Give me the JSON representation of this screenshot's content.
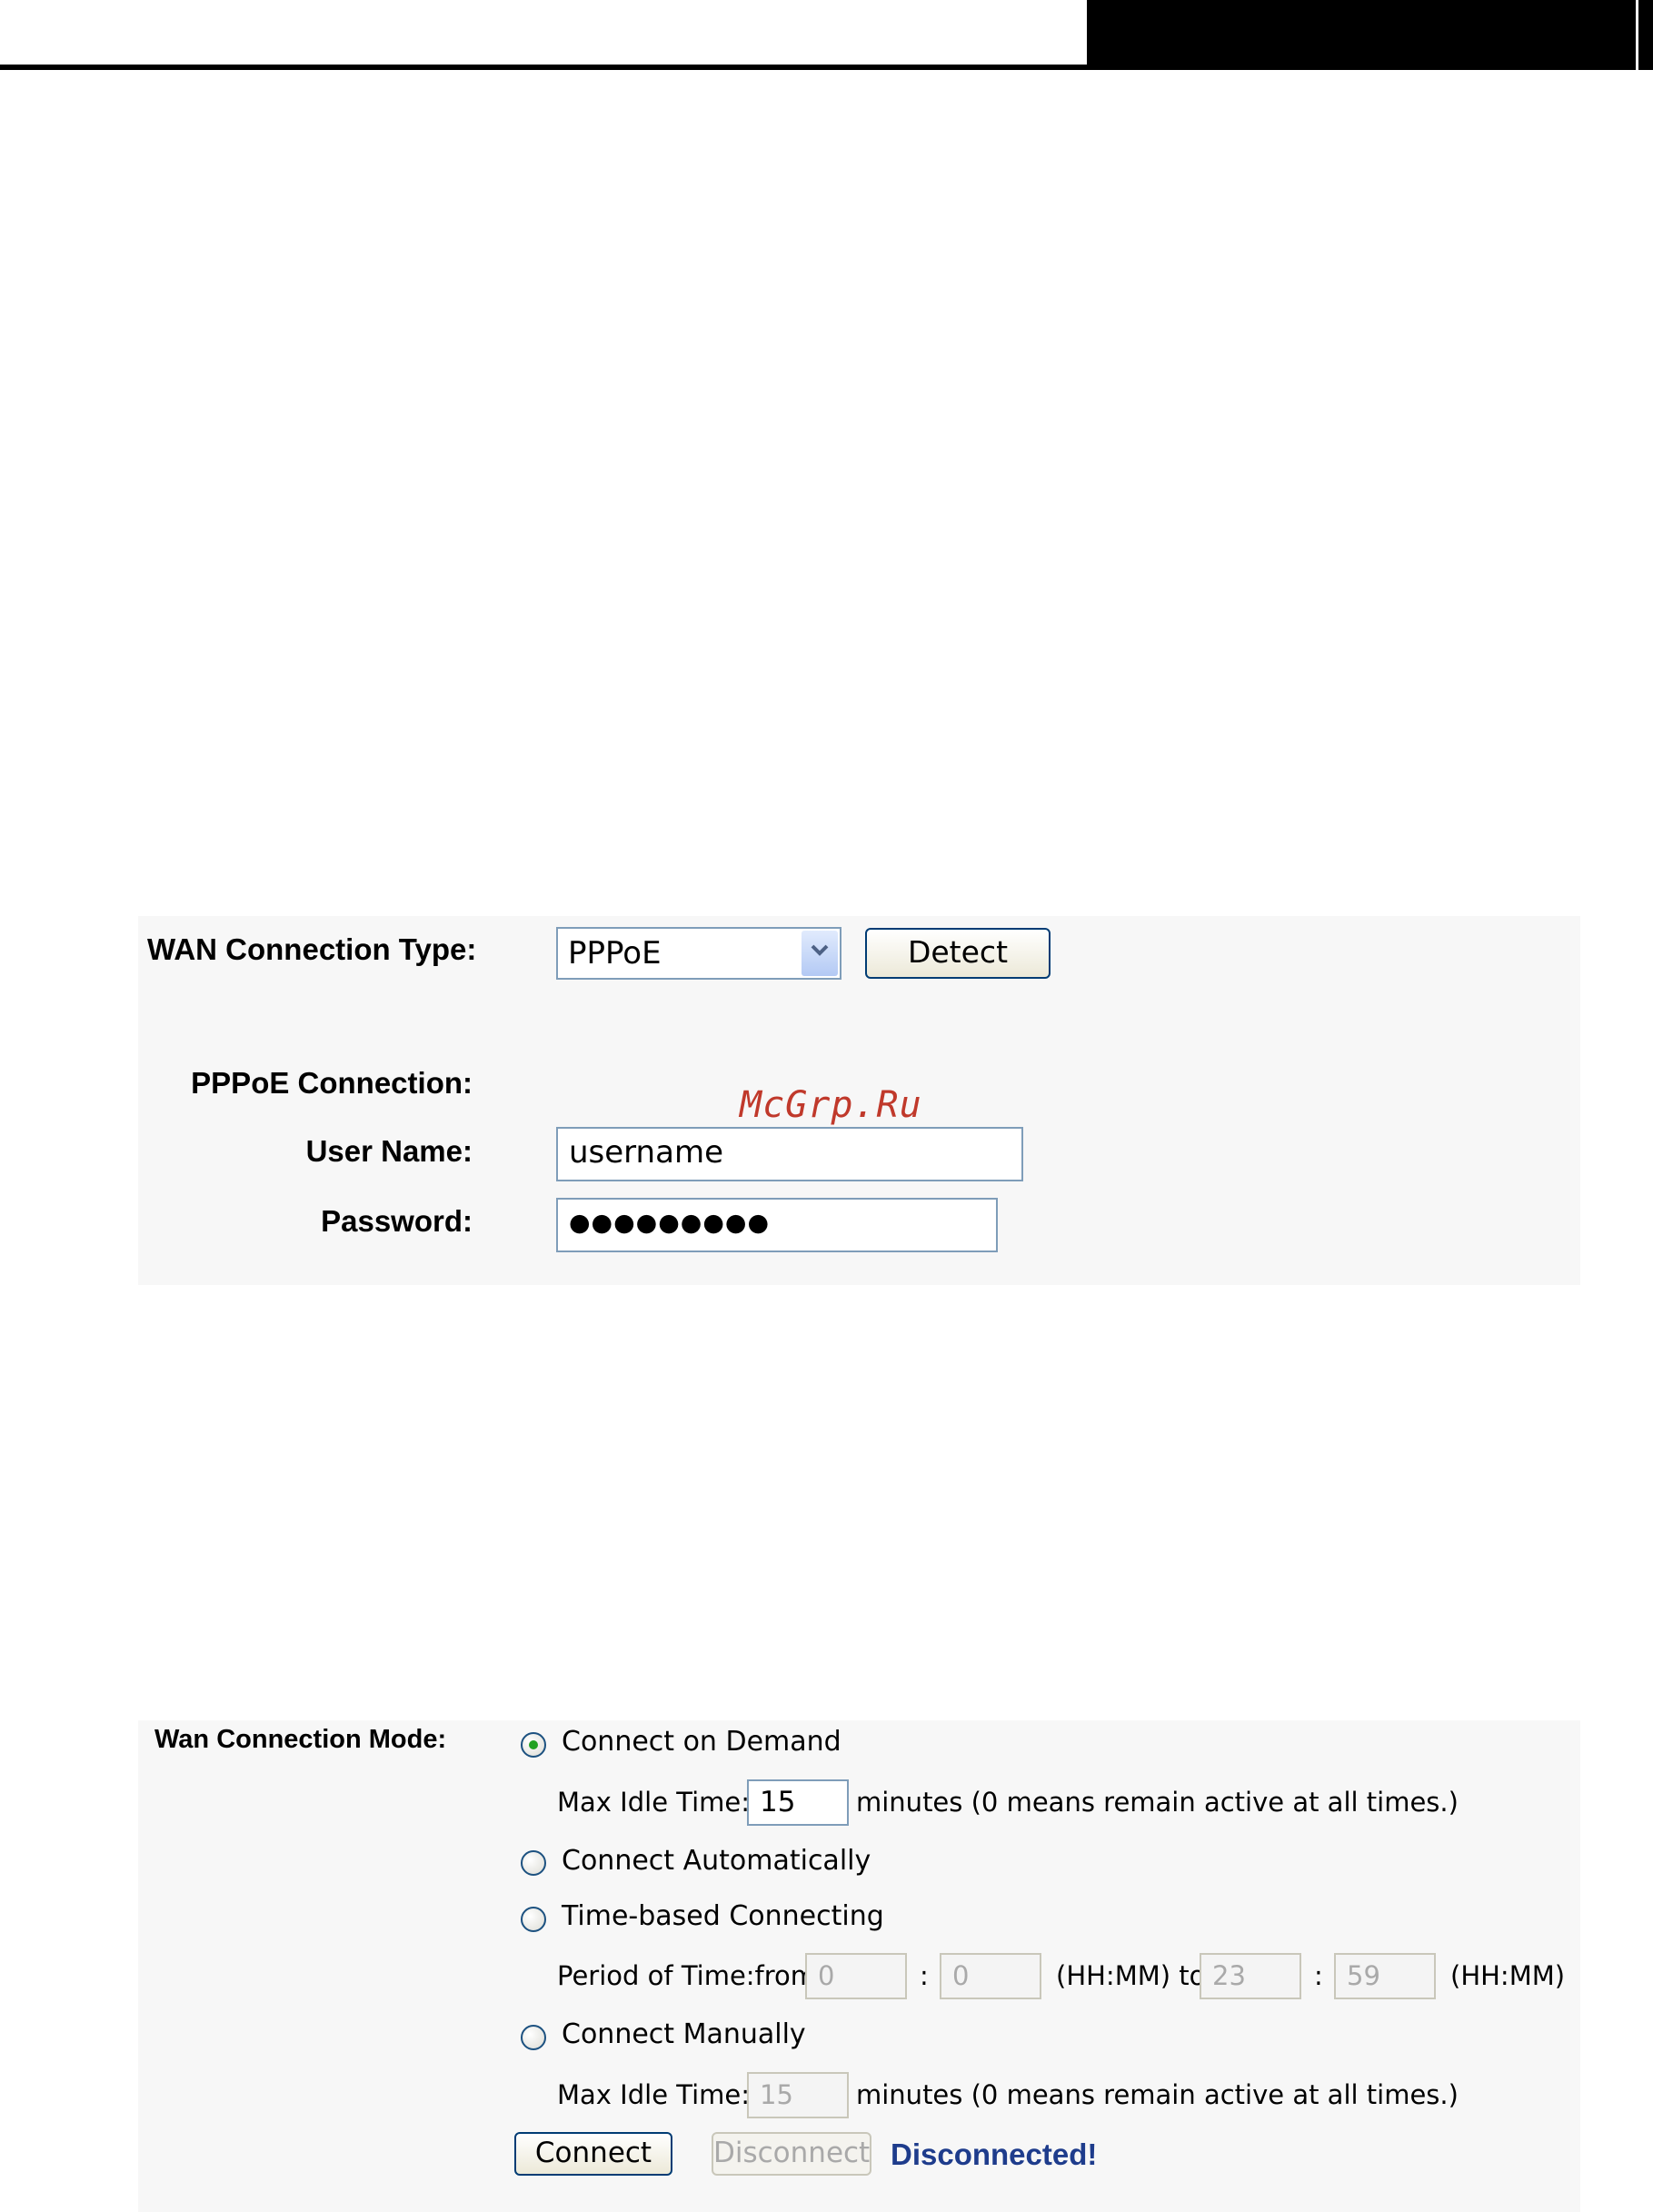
{
  "watermark": "McGrp.Ru",
  "wan_type_panel": {
    "type_label": "WAN Connection Type:",
    "type_value": "PPPoE",
    "detect_label": "Detect",
    "pppoe_label": "PPPoE Connection:",
    "username_label": "User Name:",
    "username_value": "username",
    "password_label": "Password:",
    "password_value": "●●●●●●●●●"
  },
  "mode_panel": {
    "mode_label": "Wan Connection Mode:",
    "options": [
      {
        "label": "Connect on Demand",
        "selected": true
      },
      {
        "label": "Connect Automatically",
        "selected": false
      },
      {
        "label": "Time-based Connecting",
        "selected": false
      },
      {
        "label": "Connect Manually",
        "selected": false
      }
    ],
    "demand_idle_label": "Max Idle Time:",
    "demand_idle_value": "15",
    "demand_idle_suffix": "minutes (0 means remain active at all times.)",
    "period_label": "Period of Time:from",
    "from_hh": "0",
    "from_mm": "0",
    "colon": ":",
    "hhmm_to": "(HH:MM) to",
    "to_hh": "23",
    "to_mm": "59",
    "hhmm_end": "(HH:MM)",
    "manual_idle_label": "Max Idle Time:",
    "manual_idle_value": "15",
    "manual_idle_suffix": "minutes (0 means remain active at all times.)",
    "connect_label": "Connect",
    "disconnect_label": "Disconnect",
    "status_text": "Disconnected!"
  },
  "colors": {
    "panel_bg": "#f7f7f7",
    "field_border": "#7f9db9",
    "status_blue": "#1e3c8c",
    "watermark_red": "#c0392b",
    "radio_selected": "#21a121"
  }
}
